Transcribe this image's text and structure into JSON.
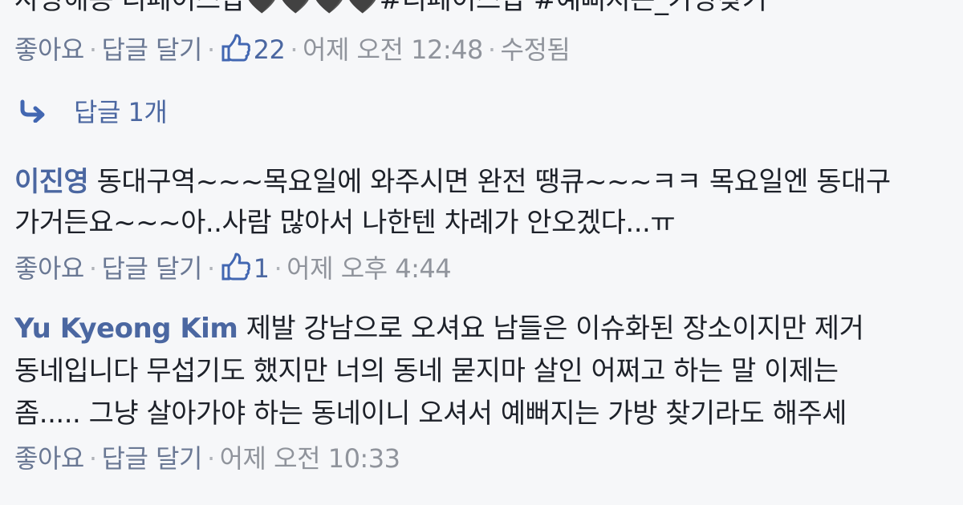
{
  "comment_top": {
    "text_line": "사랑해용 디페이스갑🖤🖤🖤🖤#디페이스갑 #예뻐지는_가방찾기",
    "meta": {
      "like": "좋아요",
      "reply": "답글 달기",
      "like_count": "22",
      "time": "어제 오전 12:48",
      "edited": "수정됨",
      "separator": "·"
    },
    "replies_toggle": "답글 1개"
  },
  "comment_2": {
    "author": "이진영",
    "line1": "동대구역~~~목요일에 와주시면 완전 땡큐~~~ㅋㅋ 목요일엔 동대구",
    "line2": "가거든요~~~아..사람 많아서 나한텐 차례가 안오겠다...ㅠ",
    "meta": {
      "like": "좋아요",
      "reply": "답글 달기",
      "like_count": "1",
      "time": "어제 오후 4:44"
    }
  },
  "comment_3": {
    "author": "Yu Kyeong Kim",
    "line1": "제발 강남으로 오셔요 남들은 이슈화된 장소이지만 제거",
    "line2": "동네입니다 무섭기도 했지만 너의 동네 묻지마 살인 어쩌고 하는 말 이제는",
    "line3": "좀..... 그냥 살아가야 하는 동네이니 오셔서 예뻐지는 가방 찾기라도 해주세",
    "meta": {
      "like": "좋아요",
      "reply": "답글 달기",
      "time": "어제 오전 10:33"
    }
  },
  "icons": {
    "like_thumb": "thumbs-up-icon",
    "reply_arrow": "reply-arrow-icon",
    "heart": "black-heart-icon"
  },
  "colors": {
    "background": "#f6f7f9",
    "author": "#4b67a1",
    "text": "#1d2129",
    "meta": "#90949c",
    "link": "#4b67a1"
  }
}
